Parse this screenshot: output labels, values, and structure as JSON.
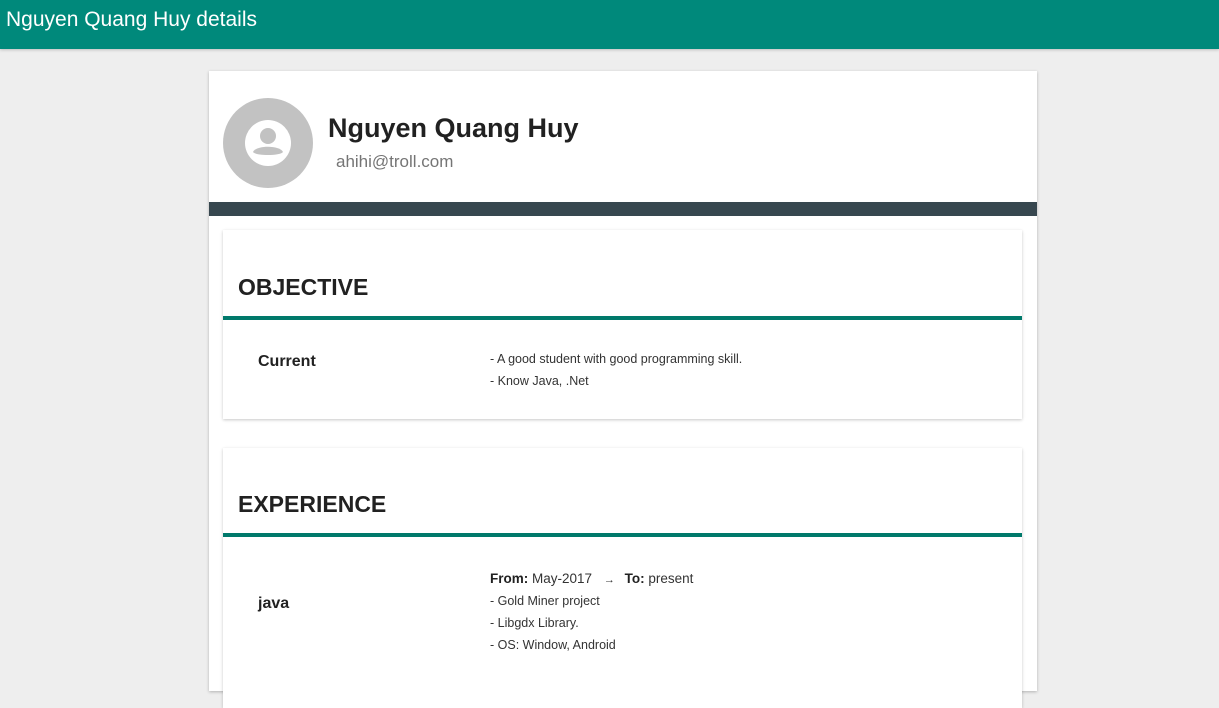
{
  "header": {
    "title": "Nguyen Quang Huy details"
  },
  "profile": {
    "name": "Nguyen Quang Huy",
    "email": "ahihi@troll.com",
    "avatar_icon": "account-circle-icon"
  },
  "objective": {
    "title": "OBJECTIVE",
    "label": "Current",
    "lines": [
      "- A good student with good programming skill.",
      "- Know Java, .Net"
    ]
  },
  "experience": {
    "title": "EXPERIENCE",
    "label": "java",
    "from_label": "From:",
    "from_value": "May-2017",
    "arrow_icon": "arrow-right-icon",
    "to_label": "To:",
    "to_value": "present",
    "lines": [
      "- Gold Miner project",
      "- Libgdx Library.",
      "- OS: Window, Android"
    ]
  },
  "colors": {
    "primary": "#00897b",
    "accent_rule": "#00796b",
    "dark_divider": "#37474f",
    "background": "#eeeeee"
  }
}
